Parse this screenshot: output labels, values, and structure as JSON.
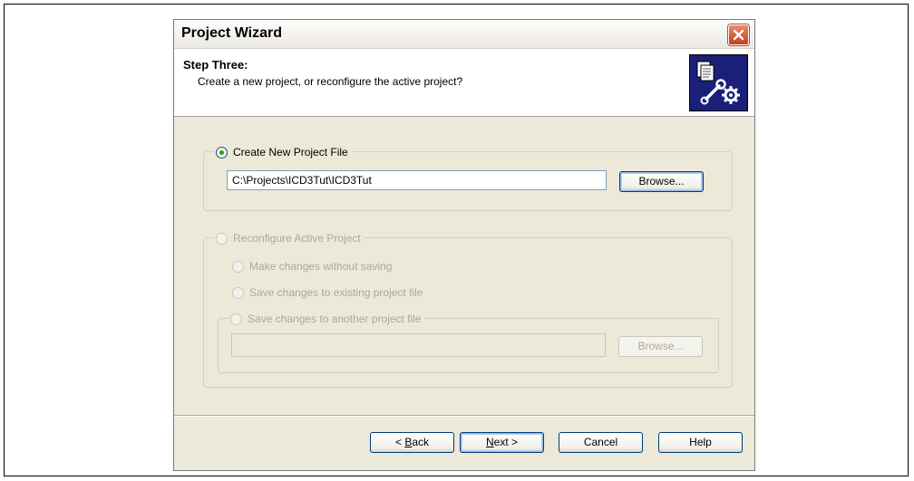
{
  "dialog": {
    "title": "Project Wizard"
  },
  "header": {
    "step_title": "Step Three:",
    "step_description": "Create a new project, or reconfigure the active project?",
    "icon": "project-settings-icon"
  },
  "create_new": {
    "label": "Create New Project File",
    "selected": true,
    "path_value": "C:\\Projects\\ICD3Tut\\ICD3Tut",
    "browse_label": "Browse..."
  },
  "reconfigure": {
    "label": "Reconfigure Active Project",
    "enabled": false,
    "options": [
      {
        "label": "Make changes without saving"
      },
      {
        "label": "Save changes to existing project file"
      }
    ],
    "save_another": {
      "label": "Save changes to another project file",
      "path_value": "",
      "browse_label": "Browse..."
    }
  },
  "footer": {
    "back": {
      "prefix": "< ",
      "mnemonic": "B",
      "rest": "ack"
    },
    "next": {
      "mnemonic": "N",
      "rest": "ext >"
    },
    "cancel_label": "Cancel",
    "help_label": "Help"
  },
  "colors": {
    "dialog_bg": "#ece9d8",
    "close_button": "#d2542f",
    "radio_selected": "#21a121",
    "disabled_text": "#aca899",
    "icon_bg": "#1a1f7a"
  }
}
